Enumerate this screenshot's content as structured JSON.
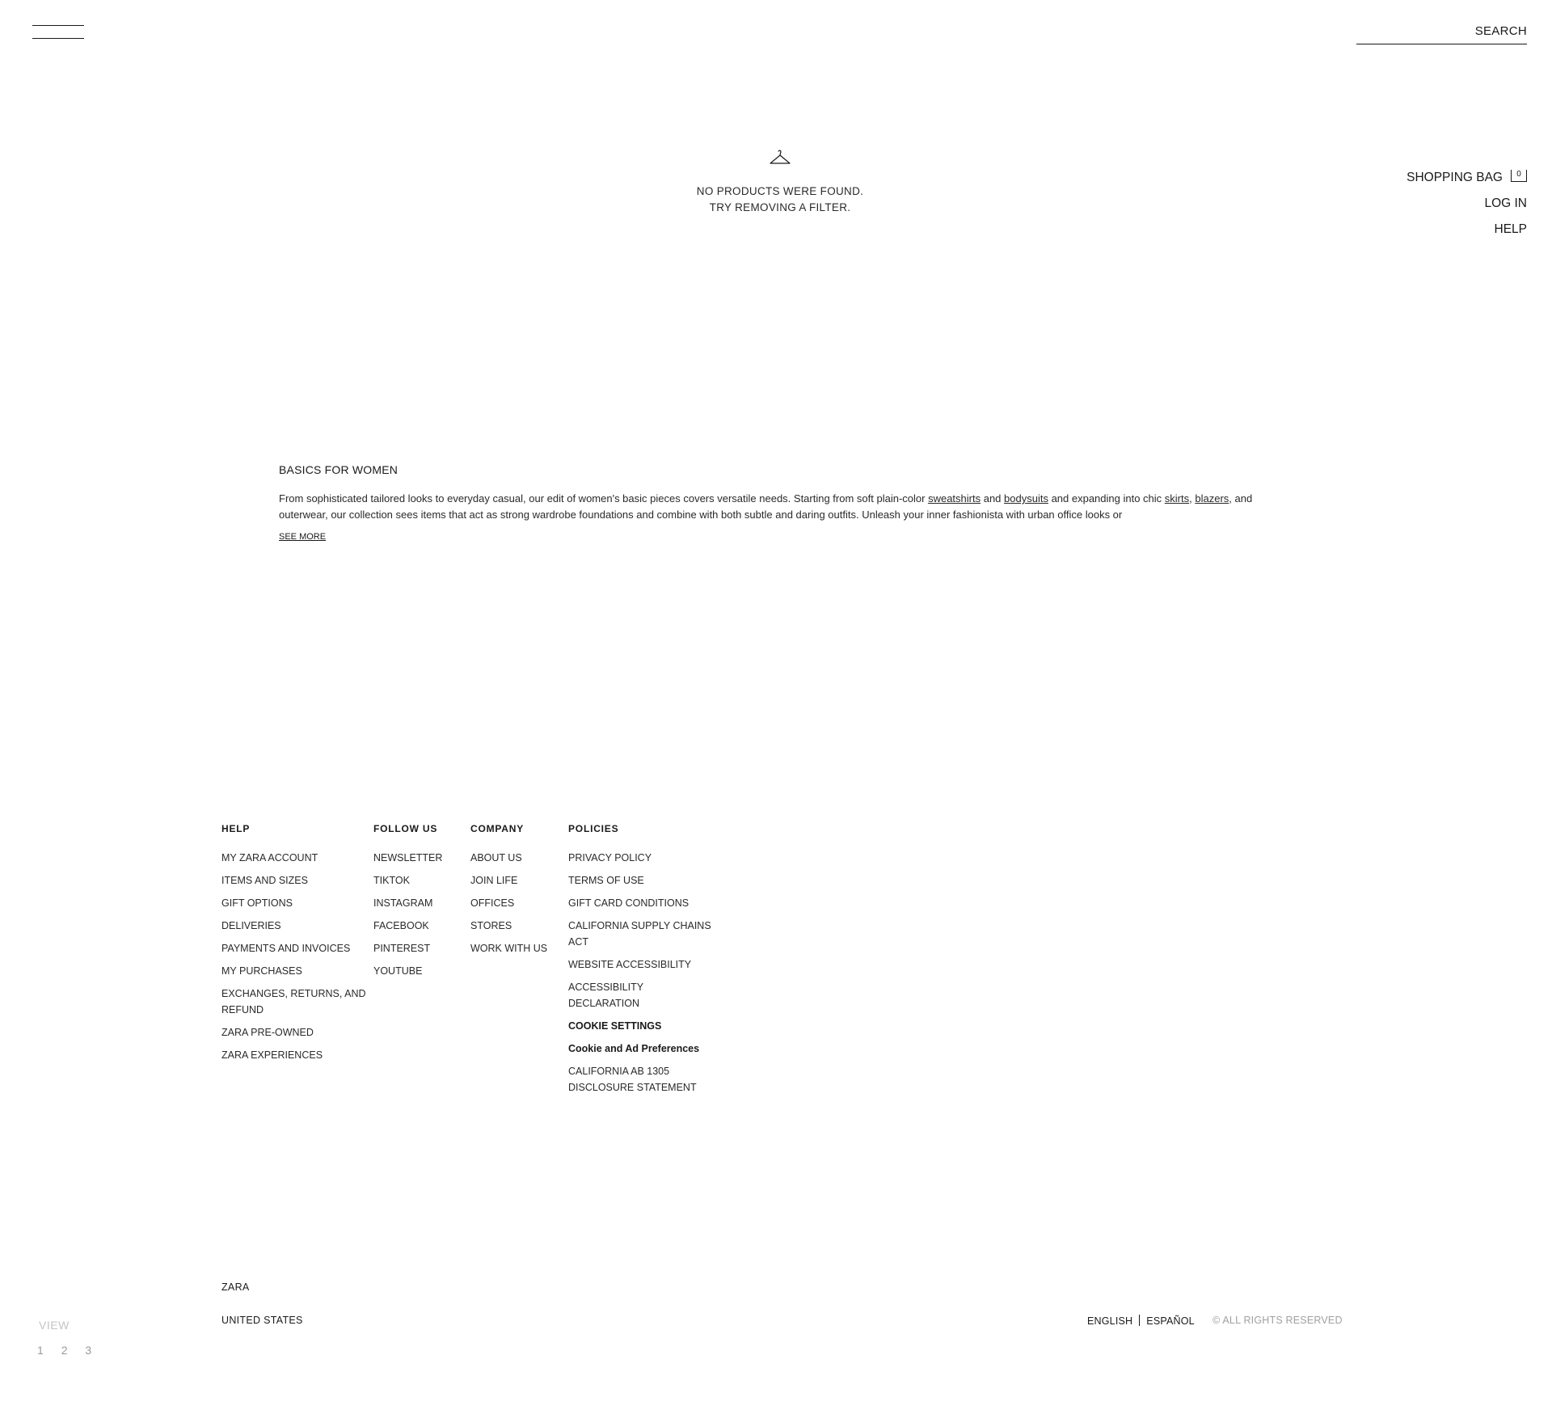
{
  "header": {
    "search_label": "SEARCH",
    "nav": {
      "shopping_bag": "SHOPPING BAG",
      "bag_count": "0",
      "log_in": "LOG IN",
      "help": "HELP"
    }
  },
  "empty_state": {
    "icon": "hanger-icon",
    "line1": "NO PRODUCTS WERE FOUND.",
    "line2": "TRY REMOVING A FILTER."
  },
  "basics": {
    "title": "BASICS FOR WOMEN",
    "desc_1": "From sophisticated tailored looks to everyday casual, our edit of women's basic pieces covers versatile needs. Starting from soft plain-color ",
    "link_sweatshirts": "sweatshirts",
    "desc_2": " and ",
    "link_bodysuits": "bodysuits",
    "desc_3": " and expanding into chic ",
    "link_skirts": "skirts",
    "desc_4": ", ",
    "link_blazers": "blazers",
    "desc_5": ", and outerwear, our collection sees items that act as strong wardrobe foundations and combine with both subtle and daring outfits. Unleash your inner fashionista with urban office looks or",
    "see_more": "SEE MORE"
  },
  "footer": {
    "help": {
      "heading": "HELP",
      "items": [
        "MY ZARA ACCOUNT",
        "ITEMS AND SIZES",
        "GIFT OPTIONS",
        "DELIVERIES",
        "PAYMENTS AND INVOICES",
        "MY PURCHASES",
        "EXCHANGES, RETURNS, AND REFUND",
        "ZARA PRE-OWNED",
        "ZARA EXPERIENCES"
      ]
    },
    "follow": {
      "heading": "FOLLOW US",
      "items": [
        "NEWSLETTER",
        "TIKTOK",
        "INSTAGRAM",
        "FACEBOOK",
        "PINTEREST",
        "YOUTUBE"
      ]
    },
    "company": {
      "heading": "COMPANY",
      "items": [
        "ABOUT US",
        "JOIN LIFE",
        "OFFICES",
        "STORES",
        "WORK WITH US"
      ]
    },
    "policies": {
      "heading": "POLICIES",
      "items": [
        "PRIVACY POLICY",
        "TERMS OF USE",
        "GIFT CARD CONDITIONS",
        "CALIFORNIA SUPPLY CHAINS ACT",
        "WEBSITE ACCESSIBILITY",
        "ACCESSIBILITY DECLARATION",
        "COOKIE SETTINGS",
        "Cookie and Ad Preferences",
        "CALIFORNIA AB 1305 DISCLOSURE STATEMENT"
      ]
    }
  },
  "bottom": {
    "brand": "ZARA",
    "country": "UNITED STATES",
    "lang_en": "ENGLISH",
    "lang_es": "ESPAÑOL",
    "rights": "© ALL RIGHTS RESERVED"
  },
  "view": {
    "label": "VIEW",
    "options": [
      "1",
      "2",
      "3"
    ]
  }
}
